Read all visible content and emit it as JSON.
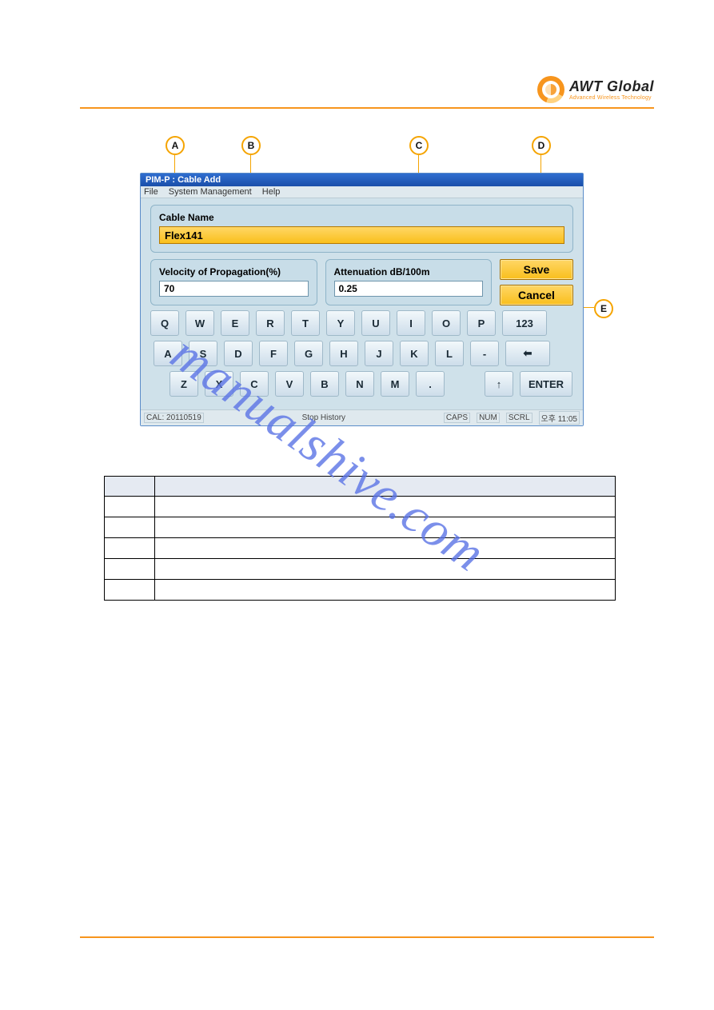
{
  "brand": {
    "title": "AWT Global",
    "sub": "Advanced Wireless Technology"
  },
  "callouts": {
    "A": "A",
    "B": "B",
    "C": "C",
    "D": "D",
    "E": "E"
  },
  "app": {
    "title": "PIM-P : Cable Add",
    "menu": {
      "file": "File",
      "sysmgmt": "System Management",
      "help": "Help"
    },
    "panels": {
      "cableName": {
        "label": "Cable Name",
        "value": "Flex141"
      },
      "vop": {
        "label": "Velocity of Propagation(%)",
        "value": "70"
      },
      "atten": {
        "label": "Attenuation dB/100m",
        "value": "0.25"
      },
      "save": "Save",
      "cancel": "Cancel"
    },
    "keyrows": [
      [
        "Q",
        "W",
        "E",
        "R",
        "T",
        "Y",
        "U",
        "I",
        "O",
        "P",
        "123"
      ],
      [
        "A",
        "S",
        "D",
        "F",
        "G",
        "H",
        "J",
        "K",
        "L",
        "-",
        "⬅"
      ],
      [
        "Z",
        "X",
        "C",
        "V",
        "B",
        "N",
        "M",
        ".",
        "",
        "↑",
        "ENTER"
      ]
    ],
    "status": {
      "cal": "CAL: 20110519",
      "stop": "Stop History",
      "caps": "CAPS",
      "num": "NUM",
      "scrl": "SCRL",
      "clock": "오후 11:05"
    }
  },
  "watermark": "manualshive.com"
}
